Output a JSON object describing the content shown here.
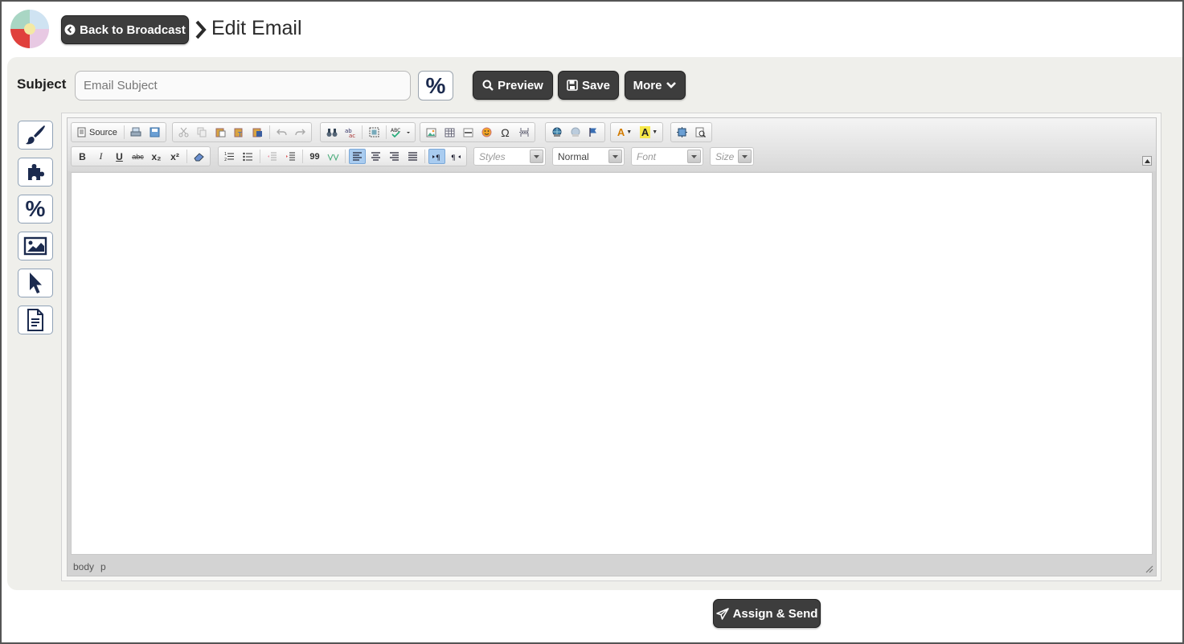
{
  "header": {
    "back_label": "Back to Broadcast",
    "title": "Edit Email"
  },
  "subject": {
    "label": "Subject",
    "placeholder": "Email Subject",
    "value": "",
    "merge_symbol": "%"
  },
  "actions": {
    "preview": "Preview",
    "save": "Save",
    "more": "More"
  },
  "tools": [
    "brush-icon",
    "puzzle-icon",
    "percent-icon",
    "image-icon",
    "cursor-icon",
    "document-icon"
  ],
  "tool_percent": "%",
  "editor": {
    "source_label": "Source",
    "styles_combo": "Styles",
    "format_combo": "Normal",
    "font_combo": "Font",
    "size_combo": "Size",
    "path": [
      "body",
      "p"
    ],
    "bold": "B",
    "italic": "I",
    "underline": "U",
    "strike": "abc",
    "subscript": "x₂",
    "superscript": "x²",
    "text_color": "A",
    "bg_color": "A",
    "omega": "Ω",
    "quote": "99"
  },
  "footer": {
    "assign_send": "Assign & Send"
  },
  "colors": {
    "dark_button": "#3d3d3d",
    "panel": "#efefeb",
    "icon_navy": "#1b2a4e",
    "active_align": "#a9ccf0"
  }
}
